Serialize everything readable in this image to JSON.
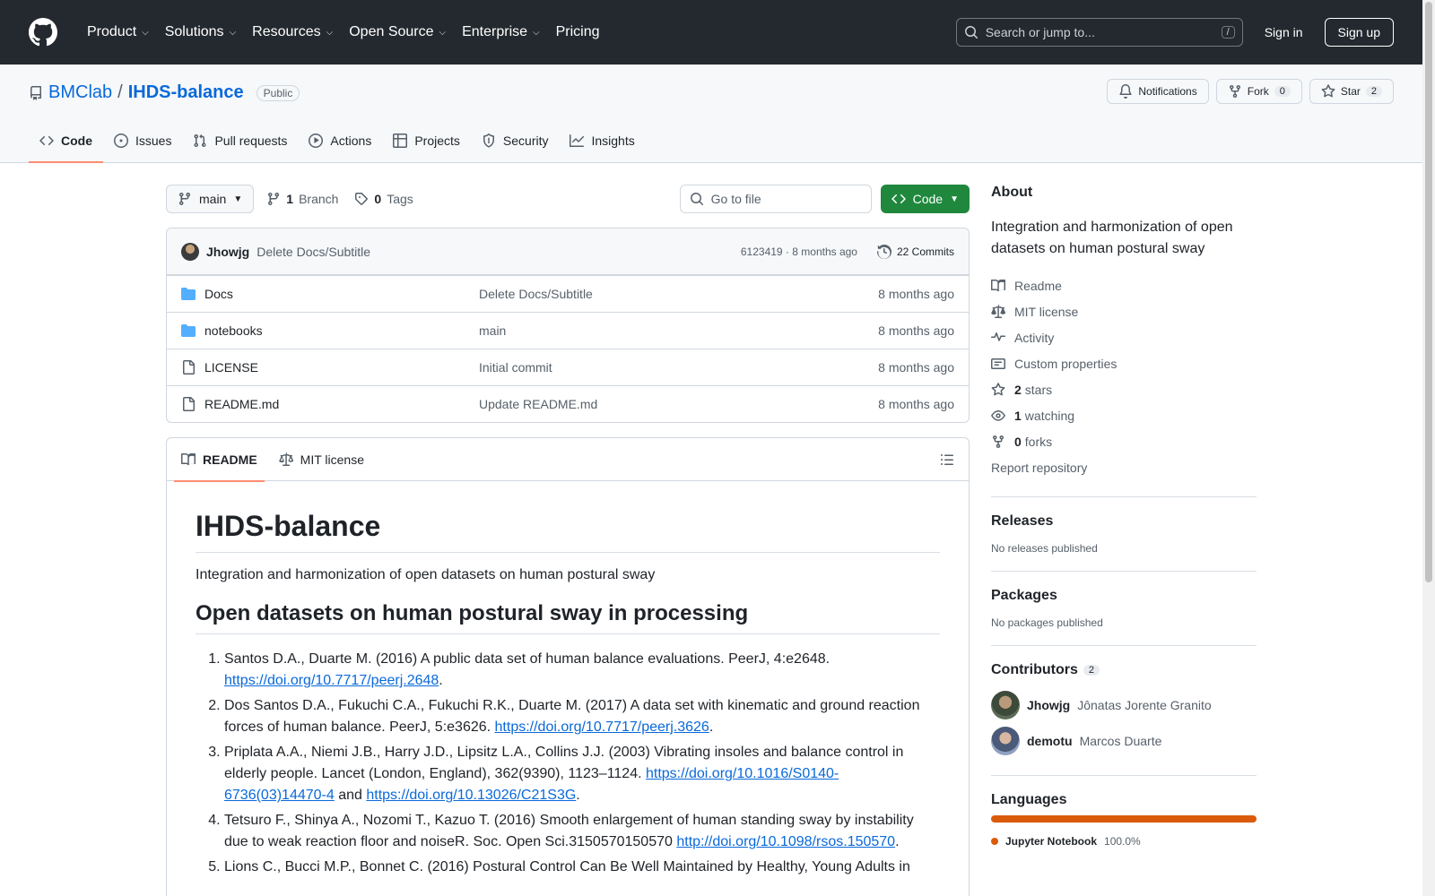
{
  "header": {
    "nav": [
      {
        "label": "Product",
        "dropdown": true
      },
      {
        "label": "Solutions",
        "dropdown": true
      },
      {
        "label": "Resources",
        "dropdown": true
      },
      {
        "label": "Open Source",
        "dropdown": true
      },
      {
        "label": "Enterprise",
        "dropdown": true
      },
      {
        "label": "Pricing",
        "dropdown": false
      }
    ],
    "search_placeholder": "Search or jump to...",
    "search_shortcut": "/",
    "sign_in": "Sign in",
    "sign_up": "Sign up"
  },
  "repo": {
    "owner": "BMClab",
    "separator": "/",
    "name": "IHDS-balance",
    "visibility": "Public",
    "notifications_label": "Notifications",
    "fork_label": "Fork",
    "fork_count": "0",
    "star_label": "Star",
    "star_count": "2",
    "tabs": [
      {
        "label": "Code",
        "icon": "code-icon",
        "active": true
      },
      {
        "label": "Issues",
        "icon": "issue-icon",
        "active": false
      },
      {
        "label": "Pull requests",
        "icon": "pull-request-icon",
        "active": false
      },
      {
        "label": "Actions",
        "icon": "play-icon",
        "active": false
      },
      {
        "label": "Projects",
        "icon": "table-icon",
        "active": false
      },
      {
        "label": "Security",
        "icon": "shield-icon",
        "active": false
      },
      {
        "label": "Insights",
        "icon": "graph-icon",
        "active": false
      }
    ]
  },
  "toolbar": {
    "branch": "main",
    "branch_count": "1",
    "branch_label": "Branch",
    "tag_count": "0",
    "tag_label": "Tags",
    "goto_placeholder": "Go to file",
    "code_button": "Code"
  },
  "latest_commit": {
    "author": "Jhowjg",
    "message": "Delete Docs/Subtitle",
    "hash": "6123419",
    "time": "8 months ago",
    "commits_label": "22 Commits"
  },
  "files": [
    {
      "name": "Docs",
      "type": "folder",
      "message": "Delete Docs/Subtitle",
      "time": "8 months ago"
    },
    {
      "name": "notebooks",
      "type": "folder",
      "message": "main",
      "time": "8 months ago"
    },
    {
      "name": "LICENSE",
      "type": "file",
      "message": "Initial commit",
      "time": "8 months ago"
    },
    {
      "name": "README.md",
      "type": "file",
      "message": "Update README.md",
      "time": "8 months ago"
    }
  ],
  "readme": {
    "tab_readme": "README",
    "tab_license": "MIT license",
    "title": "IHDS-balance",
    "intro": "Integration and harmonization of open datasets on human postural sway",
    "section_title": "Open datasets on human postural sway in processing",
    "refs": [
      {
        "text": "Santos D.A., Duarte M. (2016) A public data set of human balance evaluations. PeerJ, 4:e2648. ",
        "link1": "https://doi.org/10.7717/peerj.2648",
        "mid": "",
        "link2": "",
        "end": "."
      },
      {
        "text": "Dos Santos D.A., Fukuchi C.A., Fukuchi R.K., Duarte M. (2017) A data set with kinematic and ground reaction forces of human balance. PeerJ, 5:e3626. ",
        "link1": "https://doi.org/10.7717/peerj.3626",
        "mid": "",
        "link2": "",
        "end": "."
      },
      {
        "text": "Priplata A.A., Niemi J.B., Harry J.D., Lipsitz L.A., Collins J.J. (2003) Vibrating insoles and balance control in elderly people. Lancet (London, England), 362(9390), 1123–1124. ",
        "link1": "https://doi.org/10.1016/S0140-6736(03)14470-4",
        "mid": " and ",
        "link2": "https://doi.org/10.13026/C21S3G",
        "end": "."
      },
      {
        "text": "Tetsuro F., Shinya A., Nozomi T., Kazuo T. (2016) Smooth enlargement of human standing sway by instability due to weak reaction floor and noiseR. Soc. Open Sci.3150570150570 ",
        "link1": "http://doi.org/10.1098/rsos.150570",
        "mid": "",
        "link2": "",
        "end": "."
      },
      {
        "text": "Lions C., Bucci M.P., Bonnet C. (2016) Postural Control Can Be Well Maintained by Healthy, Young Adults in",
        "link1": "",
        "mid": "",
        "link2": "",
        "end": ""
      }
    ]
  },
  "sidebar": {
    "about_title": "About",
    "description": "Integration and harmonization of open datasets on human postural sway",
    "links": [
      {
        "icon": "book-icon",
        "count": "",
        "label": "Readme"
      },
      {
        "icon": "law-icon",
        "count": "",
        "label": "MIT license"
      },
      {
        "icon": "pulse-icon",
        "count": "",
        "label": "Activity"
      },
      {
        "icon": "note-icon",
        "count": "",
        "label": "Custom properties"
      },
      {
        "icon": "star-icon",
        "count": "2",
        "label": "stars"
      },
      {
        "icon": "eye-icon",
        "count": "1",
        "label": "watching"
      },
      {
        "icon": "fork-icon",
        "count": "0",
        "label": "forks"
      }
    ],
    "report": "Report repository",
    "releases_title": "Releases",
    "releases_text": "No releases published",
    "packages_title": "Packages",
    "packages_text": "No packages published",
    "contributors_title": "Contributors",
    "contributors_count": "2",
    "contributors": [
      {
        "login": "Jhowjg",
        "name": "Jônatas Jorente Granito"
      },
      {
        "login": "demotu",
        "name": "Marcos Duarte"
      }
    ],
    "languages_title": "Languages",
    "languages": [
      {
        "name": "Jupyter Notebook",
        "percent": "100.0%",
        "color": "#da5b0b"
      }
    ]
  },
  "colors": {
    "accent": "#0969da",
    "code_button": "#1f883d",
    "header_bg": "#24292f",
    "tab_underline": "#fd8c73"
  }
}
